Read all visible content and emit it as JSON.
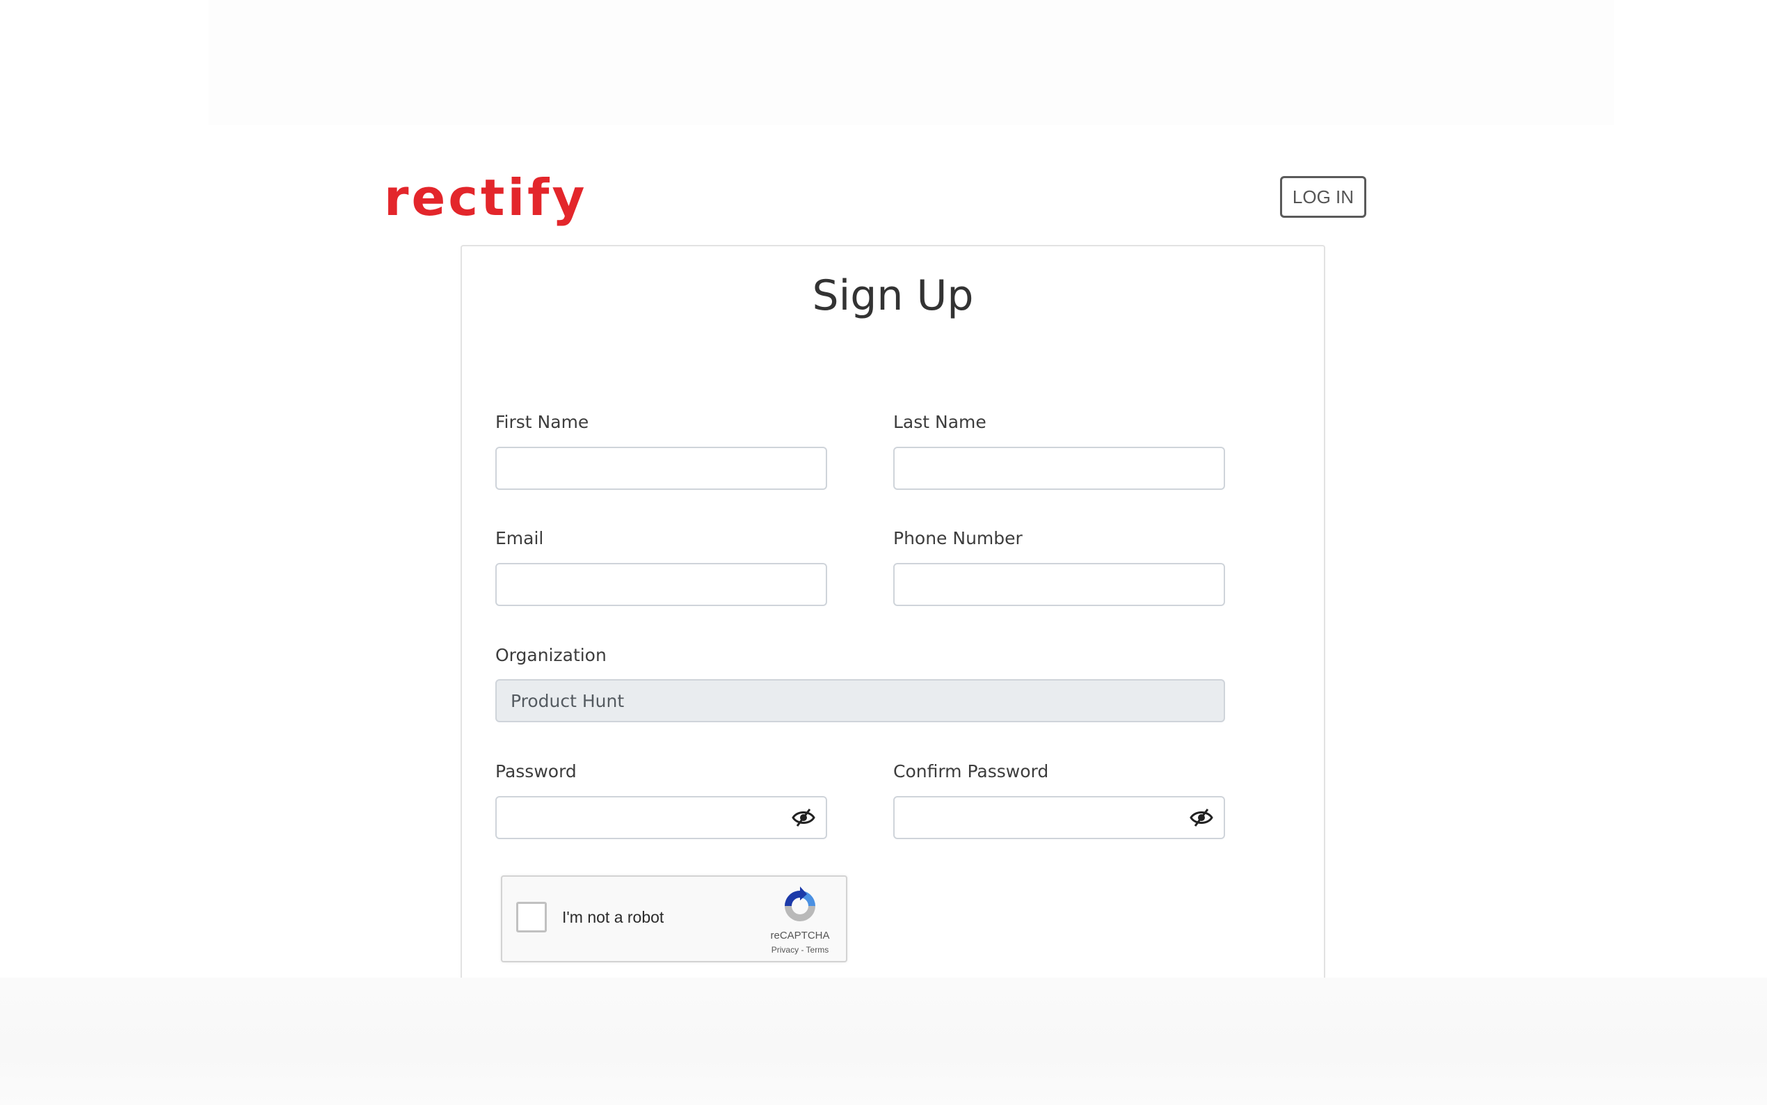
{
  "brand": {
    "logo_text": "rectify",
    "color": "#e3262b"
  },
  "header": {
    "login_label": "LOG IN"
  },
  "form": {
    "title": "Sign Up",
    "first_name": {
      "label": "First Name",
      "value": ""
    },
    "last_name": {
      "label": "Last Name",
      "value": ""
    },
    "email": {
      "label": "Email",
      "value": ""
    },
    "phone": {
      "label": "Phone Number",
      "value": ""
    },
    "organization": {
      "label": "Organization",
      "value": "Product Hunt",
      "disabled": true
    },
    "password": {
      "label": "Password",
      "value": "",
      "toggle_icon": "eye-slash-icon"
    },
    "confirm_password": {
      "label": "Confirm Password",
      "value": "",
      "toggle_icon": "eye-slash-icon"
    }
  },
  "recaptcha": {
    "checkbox_label": "I'm not a robot",
    "brand": "reCAPTCHA",
    "links": "Privacy - Terms",
    "icon": "recaptcha-logo-icon"
  },
  "colors": {
    "input_border": "#cfd4da",
    "disabled_bg": "#e9ecef",
    "card_border": "#e2e2e2"
  }
}
